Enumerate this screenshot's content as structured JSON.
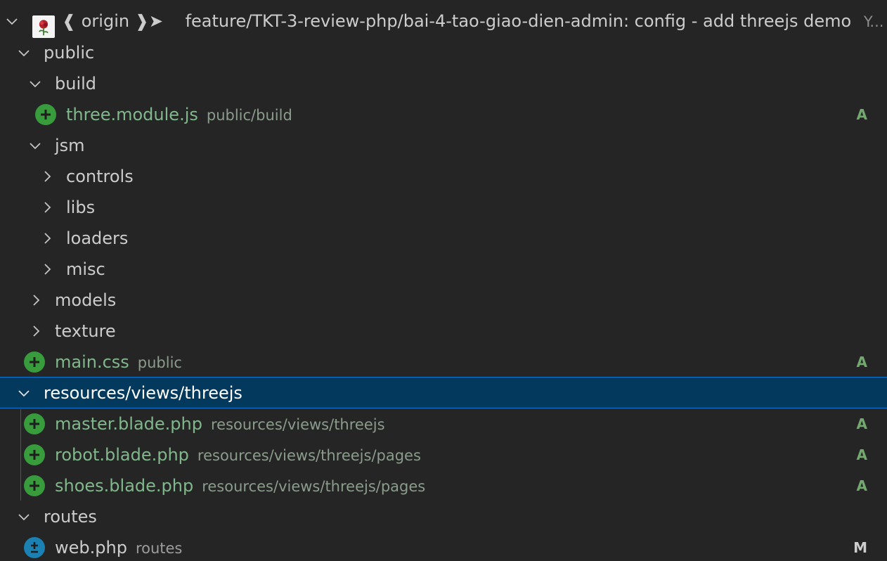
{
  "commit": {
    "ref_left": "❰",
    "remote": "origin",
    "ref_right": "❱➤",
    "message": "feature/TKT-3-review-php/bai-4-tao-giao-dien-admin: config - add threejs demo",
    "author_abbrev": "Y..."
  },
  "folders": {
    "public": "public",
    "build": "build",
    "jsm": "jsm",
    "controls": "controls",
    "libs": "libs",
    "loaders": "loaders",
    "misc": "misc",
    "models": "models",
    "texture": "texture",
    "views_threejs": "resources/views/threejs",
    "routes": "routes"
  },
  "files": [
    {
      "name": "three.module.js",
      "path": "public/build",
      "status": "A"
    },
    {
      "name": "main.css",
      "path": "public",
      "status": "A"
    },
    {
      "name": "master.blade.php",
      "path": "resources/views/threejs",
      "status": "A"
    },
    {
      "name": "robot.blade.php",
      "path": "resources/views/threejs/pages",
      "status": "A"
    },
    {
      "name": "shoes.blade.php",
      "path": "resources/views/threejs/pages",
      "status": "A"
    },
    {
      "name": "web.php",
      "path": "routes",
      "status": "M"
    }
  ],
  "colors": {
    "background": "#252526",
    "selected": "#04395e",
    "added": "#389b3c",
    "modified": "#1b80b2"
  },
  "icons": {
    "expanded": "chevron-down-icon",
    "collapsed": "chevron-right-icon",
    "added": "plus-circle-icon",
    "modified": "diff-modified-icon"
  }
}
